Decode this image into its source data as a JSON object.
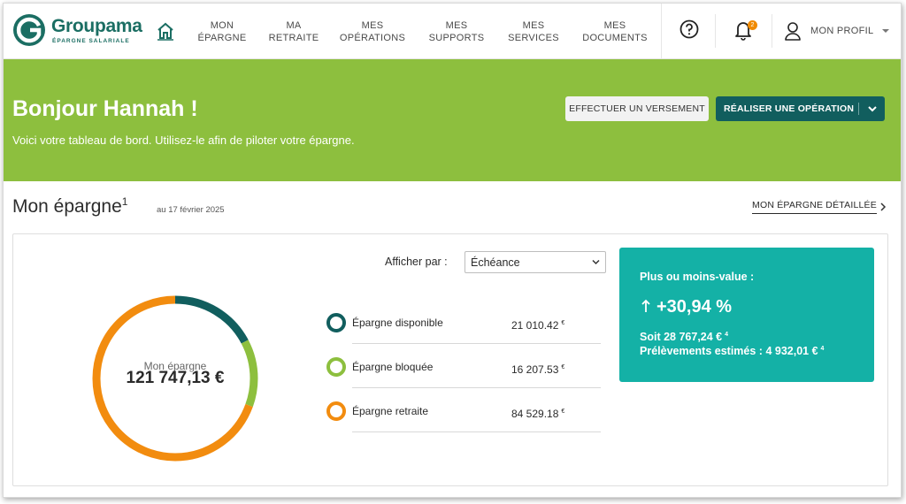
{
  "brand": {
    "name": "Groupama",
    "tagline": "ÉPARGNE SALARIALE",
    "color": "#1b6e63"
  },
  "nav": {
    "items": [
      {
        "line1": "MON",
        "line2": "ÉPARGNE"
      },
      {
        "line1": "MA",
        "line2": "RETRAITE"
      },
      {
        "line1": "MES",
        "line2": "OPÉRATIONS"
      },
      {
        "line1": "MES",
        "line2": "SUPPORTS"
      },
      {
        "line1": "MES",
        "line2": "SERVICES"
      },
      {
        "line1": "MES",
        "line2": "DOCUMENTS"
      }
    ]
  },
  "header": {
    "notification_count": "2",
    "profile_label": "MON PROFIL",
    "icons": [
      "home-icon",
      "help-icon",
      "bell-icon",
      "user-icon",
      "chevron-down-icon"
    ]
  },
  "hero": {
    "greeting": "Bonjour Hannah !",
    "intro": "Voici votre tableau de bord. Utilisez-le afin de piloter votre épargne.",
    "btn_versement": "EFFECTUER UN VERSEMENT",
    "btn_operation": "RÉALISER UNE OPÉRATION",
    "bg_color": "#8dbf3e",
    "accent_color": "#115e5e"
  },
  "section": {
    "title": "Mon épargne",
    "title_sup": "1",
    "date": "au 17 février 2025",
    "detail_link": "MON ÉPARGNE DÉTAILLÉE"
  },
  "savings": {
    "donut_label": "Mon épargne",
    "total": "121 747,13 €",
    "filter_label": "Afficher par :",
    "filter_value": "Échéance",
    "rows": [
      {
        "name": "Épargne disponible",
        "value": "21 010.42",
        "currency": "€",
        "amount": 21010.42,
        "color": "#115e5e"
      },
      {
        "name": "Épargne bloquée",
        "value": "16 207.53",
        "currency": "€",
        "amount": 16207.53,
        "color": "#8dbf3e"
      },
      {
        "name": "Épargne retraite",
        "value": "84 529.18",
        "currency": "€",
        "amount": 84529.18,
        "color": "#f28c0f"
      }
    ]
  },
  "performance": {
    "title": "Plus ou moins-value :",
    "value": "+30,94 %",
    "line1": "Soit 28 767,24 €",
    "line1_sup": "4",
    "line2": "Prélèvements estimés : 4 932,01 €",
    "line2_sup": "4",
    "bg_color": "#14b1a6"
  }
}
